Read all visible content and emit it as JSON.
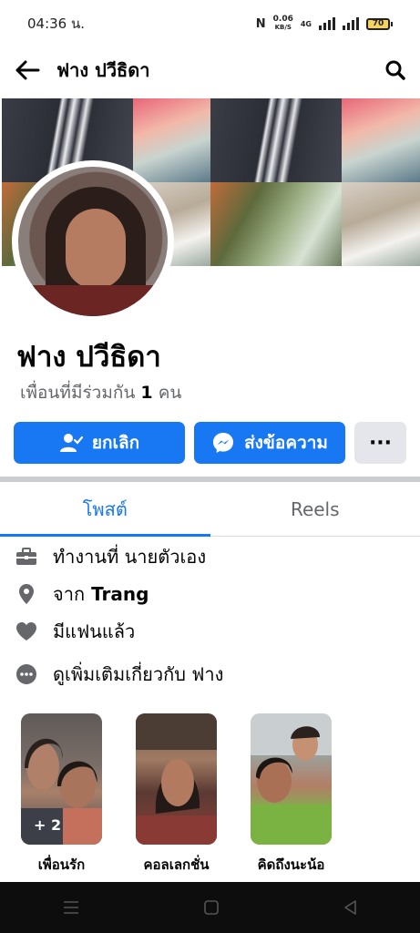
{
  "status": {
    "time": "04:36 น.",
    "speed": "0.06",
    "speed_unit": "KB/S",
    "network": "4G",
    "battery": "70"
  },
  "header": {
    "back_icon": "arrow-left-icon",
    "title": "ฟาง ปวีธิดา",
    "search_icon": "search-icon"
  },
  "profile": {
    "name": "ฟาง ปวีธิดา",
    "mutual_prefix": "เพื่อนที่มีร่วมกัน",
    "mutual_count": "1",
    "mutual_suffix": "คน"
  },
  "actions": {
    "unfollow_label": "ยกเลิก",
    "message_label": "ส่งข้อความ",
    "more_label": "···"
  },
  "tabs": [
    {
      "label": "โพสต์",
      "active": true
    },
    {
      "label": "Reels",
      "active": false
    }
  ],
  "intro": {
    "work_prefix": "ทำงานที่",
    "work_value": "นายตัวเอง",
    "from_prefix": "จาก",
    "from_value": "Trang",
    "relationship": "มีแฟนแล้ว",
    "more_about": "ดูเพิ่มเติมเกี่ยวกับ ฟาง"
  },
  "highlights": [
    {
      "label": "เพื่อนรัก",
      "count": "+ 2"
    },
    {
      "label": "คอลเลกชั่น"
    },
    {
      "label": "คิดถึงนะน้อ"
    }
  ],
  "colors": {
    "accent": "#1877f2",
    "secondary_text": "#65676b",
    "button_grey": "#e4e6eb"
  }
}
